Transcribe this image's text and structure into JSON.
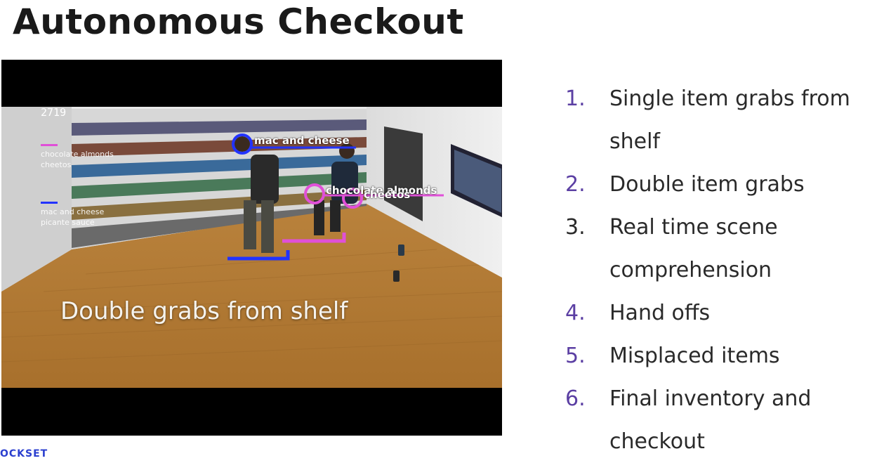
{
  "slide": {
    "title": "Autonomous Checkout",
    "brand": "OCKSET"
  },
  "video": {
    "frame_counter": "2719",
    "legend": [
      {
        "color": "#e050d8",
        "items": [
          "chocolate almonds",
          "cheetos"
        ]
      },
      {
        "color": "#2233ff",
        "items": [
          "mac and cheese",
          "picante sauce"
        ]
      }
    ],
    "detections": [
      {
        "label": "mac and cheese",
        "color": "#2233ff"
      },
      {
        "label": "chocolate almonds",
        "color": "#e050d8"
      },
      {
        "label": "cheetos",
        "color": "#e050d8"
      }
    ],
    "caption": "Double grabs from shelf"
  },
  "list": {
    "accent_color": "#5b3fa3",
    "items": [
      {
        "num": "1.",
        "text": "Single item grabs from shelf",
        "accent": true
      },
      {
        "num": "2.",
        "text": "Double item grabs",
        "accent": true
      },
      {
        "num": "3.",
        "text": "Real time scene comprehension",
        "accent": false
      },
      {
        "num": "4.",
        "text": "Hand offs",
        "accent": true
      },
      {
        "num": "5.",
        "text": "Misplaced items",
        "accent": true
      },
      {
        "num": "6.",
        "text": "Final inventory and checkout",
        "accent": true
      }
    ]
  }
}
